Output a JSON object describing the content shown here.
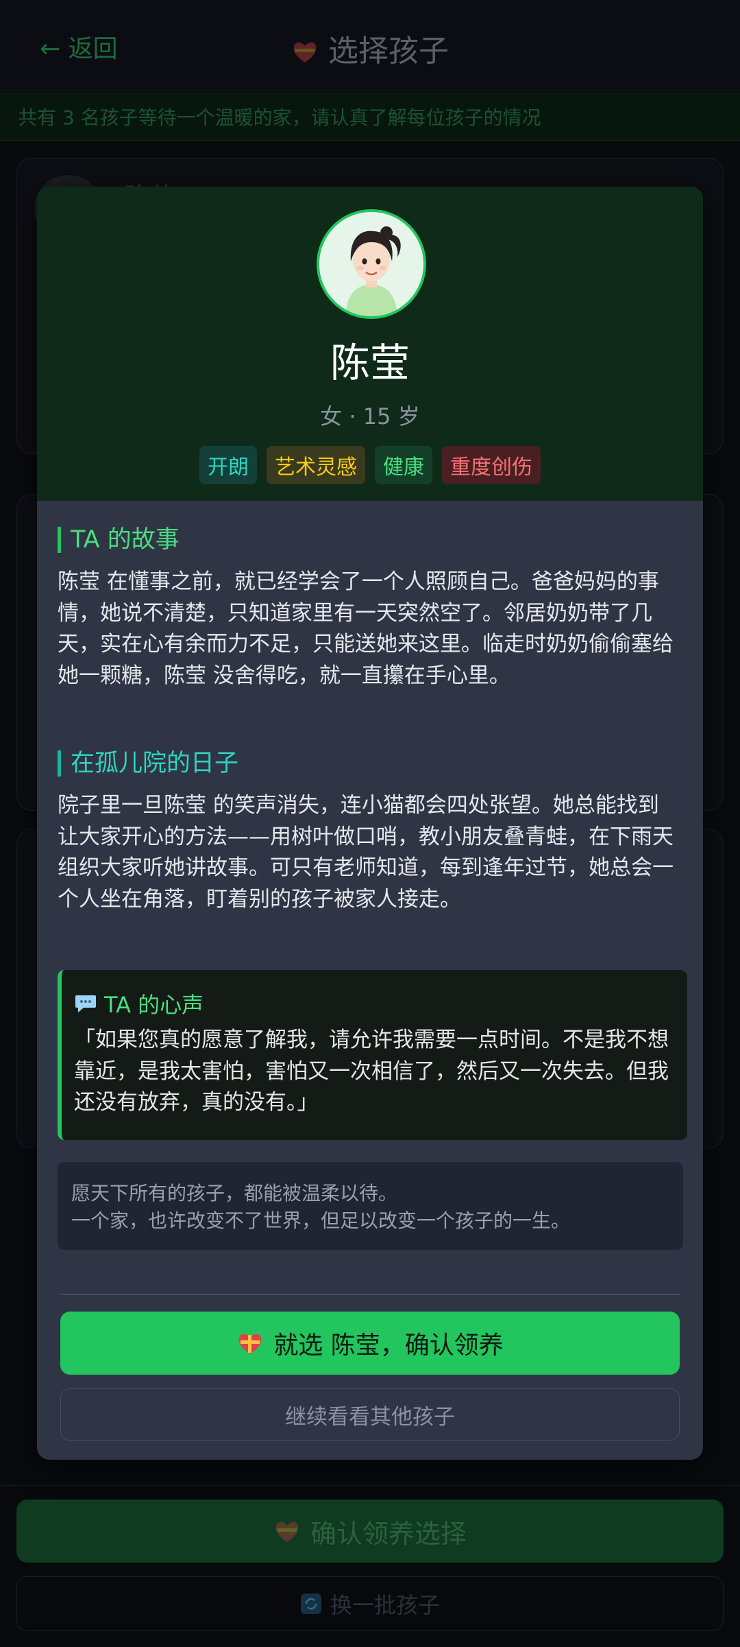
{
  "header": {
    "back_label": "← 返回",
    "title": "选择孩子",
    "title_icon": "gift-heart-icon"
  },
  "notice": "共有 3 名孩子等待一个温暖的家，请认真了解每位孩子的情况",
  "background_list": {
    "first_name_partial": "陈莹"
  },
  "modal": {
    "name": "陈莹",
    "meta": "女 · 15 岁",
    "tags": [
      "开朗",
      "艺术灵感",
      "健康",
      "重度创伤"
    ],
    "story_title": "TA 的故事",
    "story_text": "陈莹 在懂事之前，就已经学会了一个人照顾自己。爸爸妈妈的事情，她说不清楚，只知道家里有一天突然空了。邻居奶奶带了几天，实在心有余而力不足，只能送她来这里。临走时奶奶偷偷塞给她一颗糖，陈莹 没舍得吃，就一直攥在手心里。",
    "days_title": "在孤儿院的日子",
    "days_text": "院子里一旦陈莹 的笑声消失，连小猫都会四处张望。她总能找到让大家开心的方法——用树叶做口哨，教小朋友叠青蛙，在下雨天组织大家听她讲故事。可只有老师知道，每到逢年过节，她总会一个人坐在角落，盯着别的孩子被家人接走。",
    "voice_icon": "speech-bubble-icon",
    "voice_title": "TA 的心声",
    "voice_text": "「如果您真的愿意了解我，请允许我需要一点时间。不是我不想靠近，是我太害怕，害怕又一次相信了，然后又一次失去。但我还没有放弃，真的没有。」",
    "wish_line1": "愿天下所有的孩子，都能被温柔以待。",
    "wish_line2": "一个家，也许改变不了世界，但足以改变一个孩子的一生。",
    "adopt_label": "就选 陈莹，确认领养",
    "other_label": "继续看看其他孩子"
  },
  "footer": {
    "confirm_label": "确认领养选择",
    "refresh_icon": "refresh-icon",
    "refresh_label": "换一批孩子"
  },
  "colors": {
    "accent": "#22c55e",
    "modal_bg": "#2f3545",
    "header_bg": "#0f2a19"
  }
}
